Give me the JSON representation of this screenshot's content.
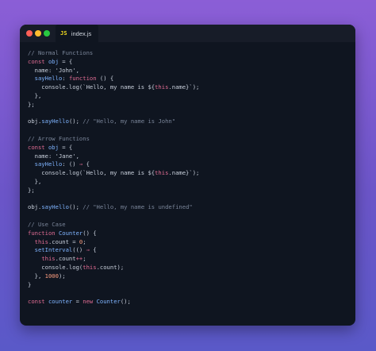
{
  "window": {
    "tab_label": "index.js",
    "tab_icon": "JS"
  },
  "code_lines": [
    [
      {
        "t": "// Normal Functions",
        "c": "c"
      }
    ],
    [
      {
        "t": "const ",
        "c": "k"
      },
      {
        "t": "obj",
        "c": "v"
      },
      {
        "t": " = {",
        "c": "p"
      }
    ],
    [
      {
        "t": "  name: 'John',",
        "c": "p"
      }
    ],
    [
      {
        "t": "  ",
        "c": "p"
      },
      {
        "t": "sayHello",
        "c": "v"
      },
      {
        "t": ": ",
        "c": "p"
      },
      {
        "t": "function",
        "c": "k"
      },
      {
        "t": " () {",
        "c": "p"
      }
    ],
    [
      {
        "t": "    console.log(`Hello, my name is ${",
        "c": "p"
      },
      {
        "t": "this",
        "c": "k"
      },
      {
        "t": ".name}`);",
        "c": "p"
      }
    ],
    [
      {
        "t": "  },",
        "c": "p"
      }
    ],
    [
      {
        "t": "};",
        "c": "p"
      }
    ],
    [
      {
        "t": "",
        "c": "p"
      }
    ],
    [
      {
        "t": "obj.",
        "c": "p"
      },
      {
        "t": "sayHello",
        "c": "v"
      },
      {
        "t": "(); ",
        "c": "p"
      },
      {
        "t": "// \"Hello, my name is John\"",
        "c": "c"
      }
    ],
    [
      {
        "t": "",
        "c": "p"
      }
    ],
    [
      {
        "t": "// Arrow Functions",
        "c": "c"
      }
    ],
    [
      {
        "t": "const ",
        "c": "k"
      },
      {
        "t": "obj",
        "c": "v"
      },
      {
        "t": " = {",
        "c": "p"
      }
    ],
    [
      {
        "t": "  name: 'Jane',",
        "c": "p"
      }
    ],
    [
      {
        "t": "  ",
        "c": "p"
      },
      {
        "t": "sayHello",
        "c": "v"
      },
      {
        "t": ": () ",
        "c": "p"
      },
      {
        "t": "⇒",
        "c": "k"
      },
      {
        "t": " {",
        "c": "p"
      }
    ],
    [
      {
        "t": "    console.log(`Hello, my name is ${",
        "c": "p"
      },
      {
        "t": "this",
        "c": "k"
      },
      {
        "t": ".name}`);",
        "c": "p"
      }
    ],
    [
      {
        "t": "  },",
        "c": "p"
      }
    ],
    [
      {
        "t": "};",
        "c": "p"
      }
    ],
    [
      {
        "t": "",
        "c": "p"
      }
    ],
    [
      {
        "t": "obj.",
        "c": "p"
      },
      {
        "t": "sayHello",
        "c": "v"
      },
      {
        "t": "(); ",
        "c": "p"
      },
      {
        "t": "// \"Hello, my name is undefined\"",
        "c": "c"
      }
    ],
    [
      {
        "t": "",
        "c": "p"
      }
    ],
    [
      {
        "t": "// Use Case",
        "c": "c"
      }
    ],
    [
      {
        "t": "function ",
        "c": "k"
      },
      {
        "t": "Counter",
        "c": "v"
      },
      {
        "t": "() {",
        "c": "p"
      }
    ],
    [
      {
        "t": "  ",
        "c": "p"
      },
      {
        "t": "this",
        "c": "k"
      },
      {
        "t": ".count = ",
        "c": "p"
      },
      {
        "t": "0",
        "c": "n"
      },
      {
        "t": ";",
        "c": "p"
      }
    ],
    [
      {
        "t": "  ",
        "c": "p"
      },
      {
        "t": "setInterval",
        "c": "v"
      },
      {
        "t": "(() ",
        "c": "p"
      },
      {
        "t": "⇒",
        "c": "k"
      },
      {
        "t": " {",
        "c": "p"
      }
    ],
    [
      {
        "t": "    ",
        "c": "p"
      },
      {
        "t": "this",
        "c": "k"
      },
      {
        "t": ".count",
        "c": "p"
      },
      {
        "t": "++",
        "c": "k"
      },
      {
        "t": ";",
        "c": "p"
      }
    ],
    [
      {
        "t": "    console.log(",
        "c": "p"
      },
      {
        "t": "this",
        "c": "k"
      },
      {
        "t": ".count);",
        "c": "p"
      }
    ],
    [
      {
        "t": "  }, ",
        "c": "p"
      },
      {
        "t": "1000",
        "c": "n"
      },
      {
        "t": ");",
        "c": "p"
      }
    ],
    [
      {
        "t": "}",
        "c": "p"
      }
    ],
    [
      {
        "t": "",
        "c": "p"
      }
    ],
    [
      {
        "t": "const ",
        "c": "k"
      },
      {
        "t": "counter",
        "c": "v"
      },
      {
        "t": " = ",
        "c": "p"
      },
      {
        "t": "new ",
        "c": "k"
      },
      {
        "t": "Counter",
        "c": "v"
      },
      {
        "t": "();",
        "c": "p"
      }
    ]
  ],
  "colors": {
    "background_top": "#8b5ed6",
    "background_bottom": "#5a59c8",
    "editor_bg": "#0f1520",
    "titlebar_bg": "#171c28",
    "comment": "#7a8599",
    "keyword": "#e06c93",
    "identifier": "#7fb4ff",
    "number": "#ff9f80"
  }
}
